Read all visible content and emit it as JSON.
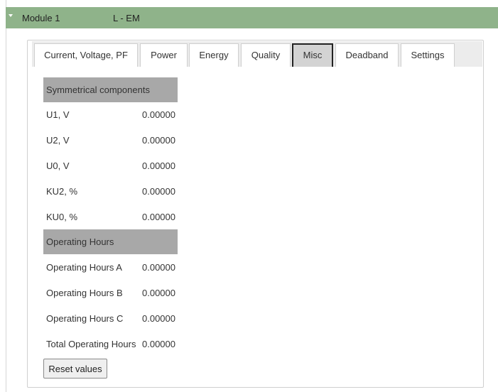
{
  "module": {
    "title": "Module 1",
    "type": "L - EM"
  },
  "tabs": [
    {
      "label": "Current, Voltage, PF",
      "active": false
    },
    {
      "label": "Power",
      "active": false
    },
    {
      "label": "Energy",
      "active": false
    },
    {
      "label": "Quality",
      "active": false
    },
    {
      "label": "Misc",
      "active": true
    },
    {
      "label": "Deadband",
      "active": false
    },
    {
      "label": "Settings",
      "active": false
    }
  ],
  "sections": {
    "symmetrical": {
      "title": "Symmetrical components",
      "rows": [
        {
          "label": "U1, V",
          "value": "0.00000"
        },
        {
          "label": "U2, V",
          "value": "0.00000"
        },
        {
          "label": "U0, V",
          "value": "0.00000"
        },
        {
          "label": "KU2, %",
          "value": "0.00000"
        },
        {
          "label": "KU0, %",
          "value": "0.00000"
        }
      ]
    },
    "hours": {
      "title": "Operating Hours",
      "rows": [
        {
          "label": "Operating Hours A",
          "value": "0.00000"
        },
        {
          "label": "Operating Hours B",
          "value": "0.00000"
        },
        {
          "label": "Operating Hours C",
          "value": "0.00000"
        },
        {
          "label": "Total Operating Hours",
          "value": "0.00000"
        }
      ]
    }
  },
  "reset_label": "Reset values"
}
